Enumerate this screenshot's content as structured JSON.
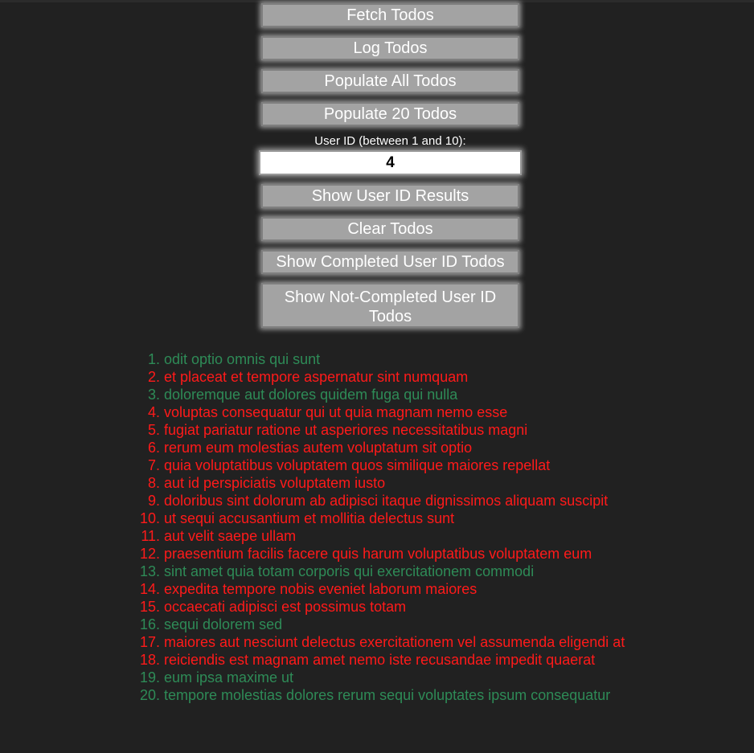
{
  "buttons": {
    "fetch": "Fetch Todos",
    "log": "Log Todos",
    "populate_all": "Populate All Todos",
    "populate_20": "Populate 20 Todos",
    "show_user": "Show User ID Results",
    "clear": "Clear Todos",
    "show_completed": "Show Completed User ID Todos",
    "show_not_completed": "Show Not-Completed User ID Todos"
  },
  "user_id": {
    "label": "User ID (between 1 and 10):",
    "value": "4"
  },
  "colors": {
    "completed": "#2e8b57",
    "not_completed": "#ff1a1a",
    "background": "#212121",
    "button": "#a3a3a3"
  },
  "todos": [
    {
      "num": "1.",
      "title": "odit optio omnis qui sunt",
      "completed": true
    },
    {
      "num": "2.",
      "title": "et placeat et tempore aspernatur sint numquam",
      "completed": false
    },
    {
      "num": "3.",
      "title": "doloremque aut dolores quidem fuga qui nulla",
      "completed": true
    },
    {
      "num": "4.",
      "title": "voluptas consequatur qui ut quia magnam nemo esse",
      "completed": false
    },
    {
      "num": "5.",
      "title": "fugiat pariatur ratione ut asperiores necessitatibus magni",
      "completed": false
    },
    {
      "num": "6.",
      "title": "rerum eum molestias autem voluptatum sit optio",
      "completed": false
    },
    {
      "num": "7.",
      "title": "quia voluptatibus voluptatem quos similique maiores repellat",
      "completed": false
    },
    {
      "num": "8.",
      "title": "aut id perspiciatis voluptatem iusto",
      "completed": false
    },
    {
      "num": "9.",
      "title": "doloribus sint dolorum ab adipisci itaque dignissimos aliquam suscipit",
      "completed": false
    },
    {
      "num": "10.",
      "title": "ut sequi accusantium et mollitia delectus sunt",
      "completed": false
    },
    {
      "num": "11.",
      "title": "aut velit saepe ullam",
      "completed": false
    },
    {
      "num": "12.",
      "title": "praesentium facilis facere quis harum voluptatibus voluptatem eum",
      "completed": false
    },
    {
      "num": "13.",
      "title": "sint amet quia totam corporis qui exercitationem commodi",
      "completed": true
    },
    {
      "num": "14.",
      "title": "expedita tempore nobis eveniet laborum maiores",
      "completed": false
    },
    {
      "num": "15.",
      "title": "occaecati adipisci est possimus totam",
      "completed": false
    },
    {
      "num": "16.",
      "title": "sequi dolorem sed",
      "completed": true
    },
    {
      "num": "17.",
      "title": "maiores aut nesciunt delectus exercitationem vel assumenda eligendi at",
      "completed": false
    },
    {
      "num": "18.",
      "title": "reiciendis est magnam amet nemo iste recusandae impedit quaerat",
      "completed": false
    },
    {
      "num": "19.",
      "title": "eum ipsa maxime ut",
      "completed": true
    },
    {
      "num": "20.",
      "title": "tempore molestias dolores rerum sequi voluptates ipsum consequatur",
      "completed": true
    }
  ]
}
